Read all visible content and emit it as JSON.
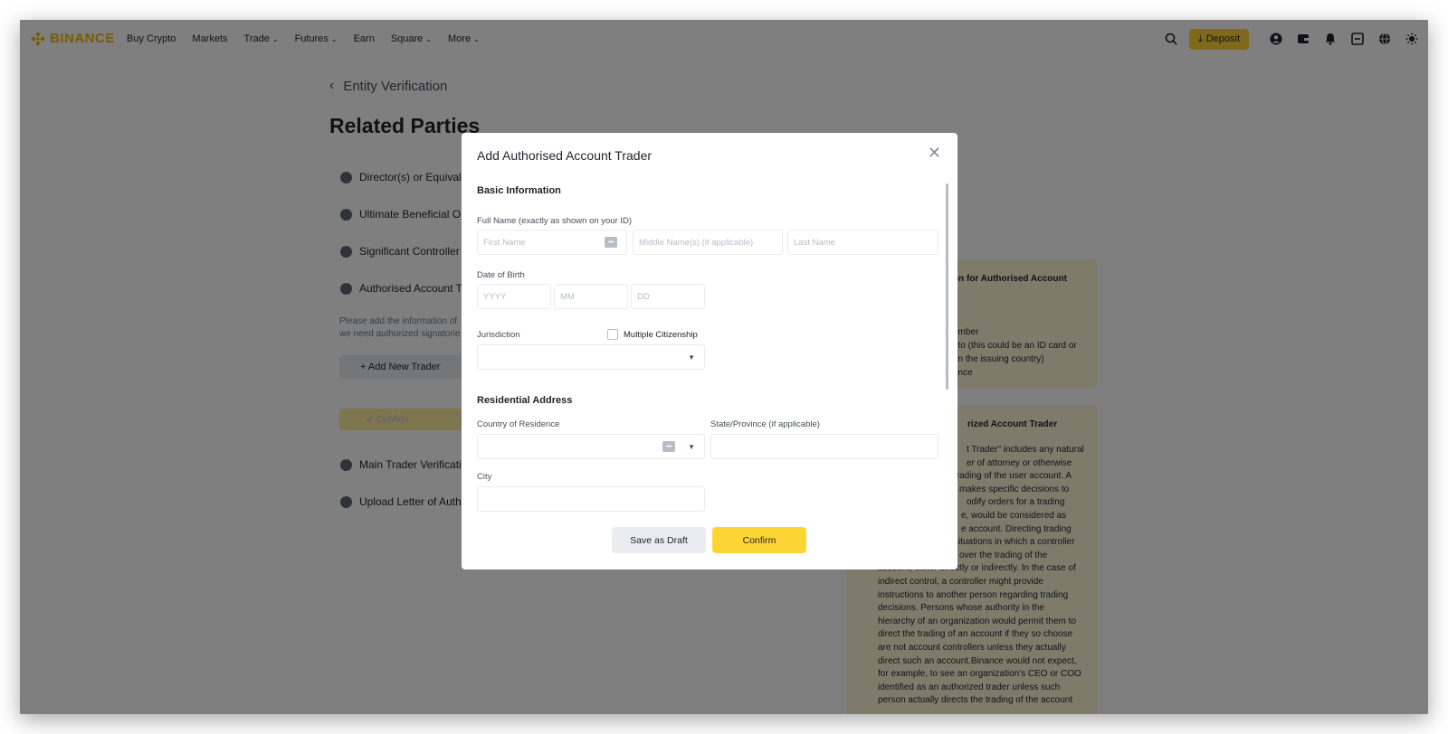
{
  "nav": {
    "logo": "BINANCE",
    "links": [
      {
        "label": "Buy Crypto",
        "chevron": false
      },
      {
        "label": "Markets",
        "chevron": false
      },
      {
        "label": "Trade",
        "chevron": true
      },
      {
        "label": "Futures",
        "chevron": true
      },
      {
        "label": "Earn",
        "chevron": false
      },
      {
        "label": "Square",
        "chevron": true
      },
      {
        "label": "More",
        "chevron": true
      }
    ],
    "deposit_label": "Deposit",
    "icons": [
      "search-icon",
      "user-icon",
      "wallet-icon",
      "bell-icon",
      "download-app-icon",
      "globe-icon",
      "theme-icon"
    ]
  },
  "page": {
    "back_label": "Entity Verification",
    "title": "Related Parties",
    "parties": [
      {
        "label": "Director(s) or Equival"
      },
      {
        "label": "Ultimate Beneficial O"
      },
      {
        "label": "Significant Controller"
      },
      {
        "label": "Authorised Account T"
      }
    ],
    "help_line1": "Please add the information of",
    "help_line2": "we need authorized signatorie",
    "add_trader_label": "+ Add New Trader",
    "confirm_label": "✔ Confirm",
    "parties_lower": [
      {
        "label": "Main Trader Verificati"
      },
      {
        "label": "Upload Letter of Auth"
      }
    ],
    "info_panel_1": {
      "title": "on for Authorised Account",
      "lines": [
        "n",
        "umber",
        "oto (this could be an ID card or",
        "on the issuing country)",
        "ence"
      ]
    },
    "info_panel_2": {
      "title": "rized Account Trader",
      "lines": [
        "t Trader\" includes any natural",
        "er of attorney or otherwise",
        "trading of the user account. A",
        "makes specific decisions to",
        "odify orders for a trading",
        "e, would be considered as",
        "e account. Directing trading",
        "situations in which a controller",
        "over the trading of the",
        "account, either directly or indirectly. In the case of",
        "indirect control, a controller might provide",
        "instructions to another person regarding trading",
        "decisions. Persons whose authority in the",
        "hierarchy of an organization would permit them to",
        "direct the trading of an account if they so choose",
        "are not account controllers unless they actually",
        "direct such an account.Binance would not expect,",
        "for example, to see an organization's CEO or COO",
        "identified as an authorized trader unless such",
        "person actually directs the trading of the account"
      ]
    }
  },
  "modal": {
    "title": "Add Authorised Account Trader",
    "basic_info_heading": "Basic Information",
    "full_name_label": "Full Name (exactly as shown on your ID)",
    "first_name_placeholder": "First Name",
    "middle_name_placeholder": "Middle Name(s) (if applicable)",
    "last_name_placeholder": "Last Name",
    "dob_label": "Date of Birth",
    "dob_year_placeholder": "YYYY",
    "dob_month_placeholder": "MM",
    "dob_day_placeholder": "DD",
    "jurisdiction_label": "Jurisdiction",
    "multiple_citizenship_label": "Multiple Citizenship",
    "residential_heading": "Residential Address",
    "country_label": "Country of Residence",
    "state_label": "State/Province (if applicable)",
    "city_label": "City",
    "save_draft_label": "Save as Draft",
    "confirm_label": "Confirm"
  },
  "colors": {
    "brand": "#f0b90b",
    "primary_button": "#fcd535",
    "info_panel": "#fdf6d7"
  }
}
